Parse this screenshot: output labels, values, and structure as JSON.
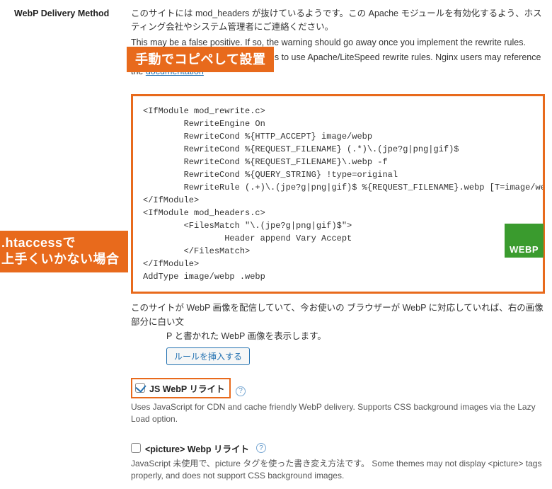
{
  "label": "WebP Delivery Method",
  "warn_jp": "このサイトには mod_headers が抜けているようです。この Apache モジュールを有効化するよう、ホスティング会社やシステム管理者にご連絡ください。",
  "warn_en": "This may be a false positive. If so, the warning should go away once you implement the rewrite rules.",
  "rec_prefix": "The recommended delivery method is to use Apache/LiteSpeed rewrite rules. Nginx users may reference the ",
  "doc_link": "documentation",
  "callout1": "手動でコピペして設置",
  "code": "<IfModule mod_rewrite.c>\n        RewriteEngine On\n        RewriteCond %{HTTP_ACCEPT} image/webp\n        RewriteCond %{REQUEST_FILENAME} (.*)\\.(jpe?g|png|gif)$\n        RewriteCond %{REQUEST_FILENAME}\\.webp -f\n        RewriteCond %{QUERY_STRING} !type=original\n        RewriteRule (.+)\\.(jpe?g|png|gif)$ %{REQUEST_FILENAME}.webp [T=image/webp,L]\n</IfModule>\n<IfModule mod_headers.c>\n        <FilesMatch \"\\.(jpe?g|png|gif)$\">\n                Header append Vary Accept\n        </FilesMatch>\n</IfModule>\nAddType image/webp .webp",
  "desc_jp_a": "このサイトが WebP 画像を配信していて、今お使いの ブラウザーが WebP に対応していれば、右の画像部分に白い文",
  "desc_jp_b": "P と書かれた WebP 画像を表示します。",
  "webp_badge": "WEBP",
  "callout2_l1": ".htaccessで",
  "callout2_l2": "上手くいかない場合",
  "insert_btn": "ルールを挿入する",
  "opt1_label": "JS WebP リライト",
  "opt1_desc": "Uses JavaScript for CDN and cache friendly WebP delivery. Supports CSS background images via the Lazy Load option.",
  "opt2_label": "<picture> Webp リライト",
  "opt2_desc": "JavaScript 未使用で、picture タグを使った書き変え方法です。 Some themes may not display <picture> tags properly, and does not support CSS background images.",
  "help": "?"
}
